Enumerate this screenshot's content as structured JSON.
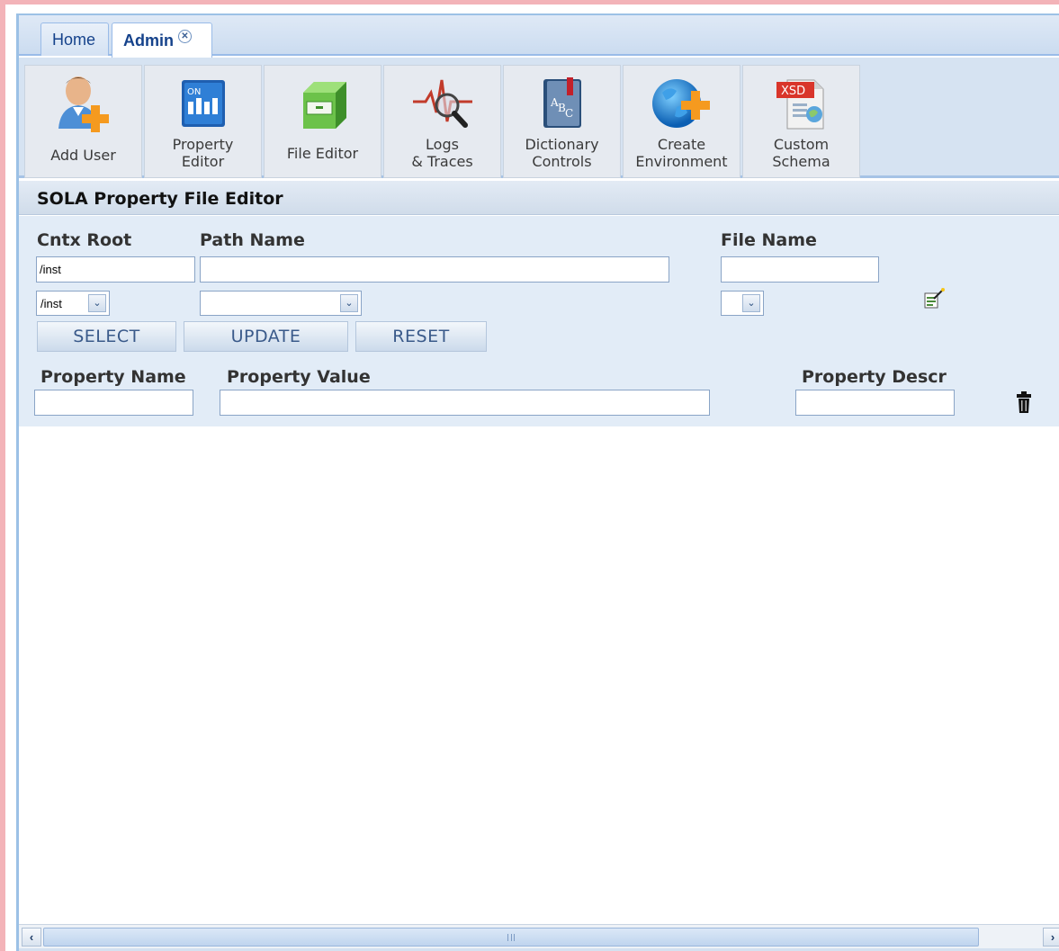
{
  "tabs": [
    {
      "label": "Home"
    },
    {
      "label": "Admin",
      "close_symbol": "✕"
    }
  ],
  "toolbar": {
    "add_user": "Add User",
    "property_editor": "Property\nEditor",
    "file_editor": "File Editor",
    "logs_traces": "Logs\n& Traces",
    "dictionary_controls": "Dictionary\nControls",
    "create_environment": "Create\nEnvironment",
    "custom_schema": "Custom\nSchema",
    "icons": {
      "property_editor_badge": "ON",
      "xsd_badge": "XSD"
    }
  },
  "panel": {
    "title": "SOLA Property File Editor",
    "labels": {
      "cntx_root": "Cntx Root",
      "path_name": "Path Name",
      "file_name": "File Name",
      "property_name": "Property Name",
      "property_value": "Property Value",
      "property_descr": "Property Descr"
    },
    "fields": {
      "cntx_root_value": "/inst",
      "path_name_value": "",
      "file_name_value": "",
      "property_name_value": "",
      "property_value_value": "",
      "property_descr_value": ""
    },
    "selects": {
      "cntx_root_selected": "/inst",
      "path_name_selected": "",
      "file_name_selected": ""
    },
    "buttons": {
      "select": "SELECT",
      "update": "UPDATE",
      "reset": "RESET"
    }
  },
  "colors": {
    "accent": "#15428b",
    "panel_bg": "#e2ecf7",
    "toolbar_bg": "#d6e3f2",
    "orange_plus": "#f59a1f"
  }
}
